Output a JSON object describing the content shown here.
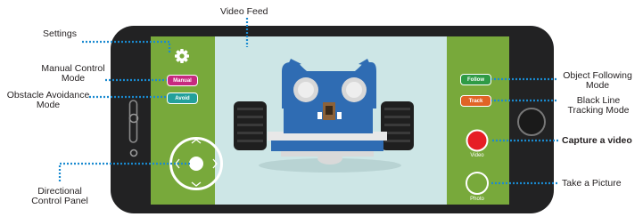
{
  "labels": {
    "video_feed": "Video Feed",
    "settings": "Settings",
    "manual_l1": "Manual Control",
    "manual_l2": "Mode",
    "avoid_l1": "Obstacle Avoidance",
    "avoid_l2": "Mode",
    "directional_l1": "Directional",
    "directional_l2": "Control Panel",
    "follow_l1": "Object Following",
    "follow_l2": "Mode",
    "track_l1": "Black Line",
    "track_l2": "Tracking Mode",
    "capture_video": "Capture a video",
    "take_picture": "Take a Picture"
  },
  "app": {
    "manual_button": "Manual",
    "avoid_button": "Avoid",
    "follow_button": "Follow",
    "track_button": "Track",
    "video_caption": "Video",
    "photo_caption": "Photo"
  },
  "icons": [
    "gear-icon",
    "chevron-up-icon",
    "chevron-down-icon",
    "chevron-left-icon",
    "chevron-right-icon",
    "record-icon",
    "camera-shutter-icon"
  ],
  "colors": {
    "phone": "#222223",
    "side_panel": "#78a93b",
    "feed_bg": "#cde6e6",
    "callout": "#1a8ad0",
    "manual_button": "#c72a7f",
    "avoid_button": "#23a09b",
    "follow_button": "#2f9b46",
    "track_button": "#e06326",
    "record": "#e61e25",
    "robot_blue": "#2f6cb3"
  }
}
